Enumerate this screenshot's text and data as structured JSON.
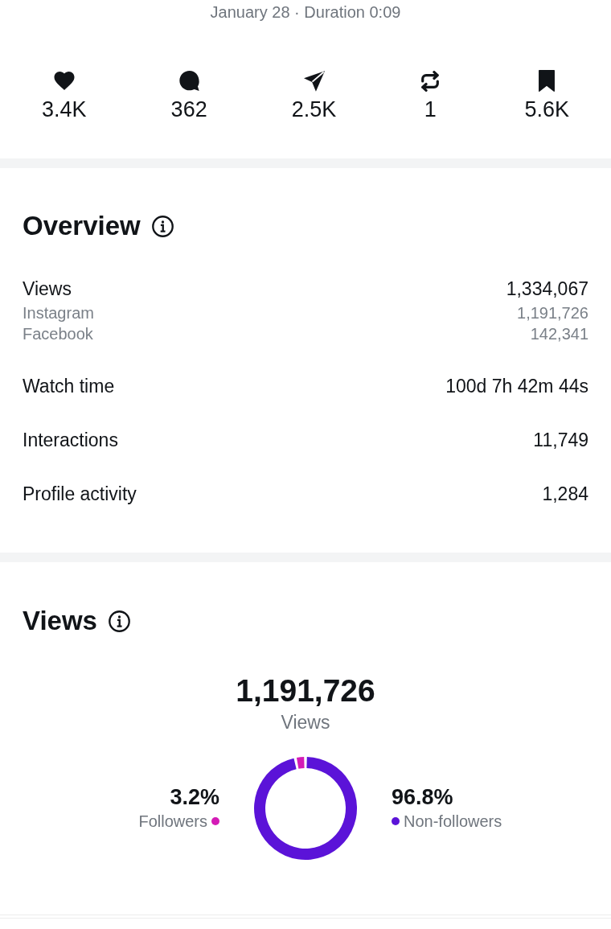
{
  "header": {
    "meta": "January 28 · Duration 0:09"
  },
  "stats": [
    {
      "kind": "likes",
      "value": "3.4K"
    },
    {
      "kind": "comments",
      "value": "362"
    },
    {
      "kind": "shares",
      "value": "2.5K"
    },
    {
      "kind": "reposts",
      "value": "1"
    },
    {
      "kind": "saves",
      "value": "5.6K"
    }
  ],
  "overview": {
    "title": "Overview",
    "rows": [
      {
        "label": "Views",
        "value": "1,334,067",
        "breakdown": [
          {
            "label": "Instagram",
            "value": "1,191,726"
          },
          {
            "label": "Facebook",
            "value": "142,341"
          }
        ]
      },
      {
        "label": "Watch time",
        "value": "100d 7h 42m 44s"
      },
      {
        "label": "Interactions",
        "value": "11,749"
      },
      {
        "label": "Profile activity",
        "value": "1,284"
      }
    ]
  },
  "views": {
    "title": "Views",
    "total": "1,191,726",
    "total_label": "Views",
    "chart_data": {
      "type": "donut",
      "categories": [
        "Followers",
        "Non-followers"
      ],
      "values": [
        3.2,
        96.8
      ]
    },
    "legend": [
      {
        "percent": "3.2%",
        "color": "#d41bb6"
      },
      {
        "percent": "96.8%",
        "color": "#5b13d8"
      }
    ]
  }
}
